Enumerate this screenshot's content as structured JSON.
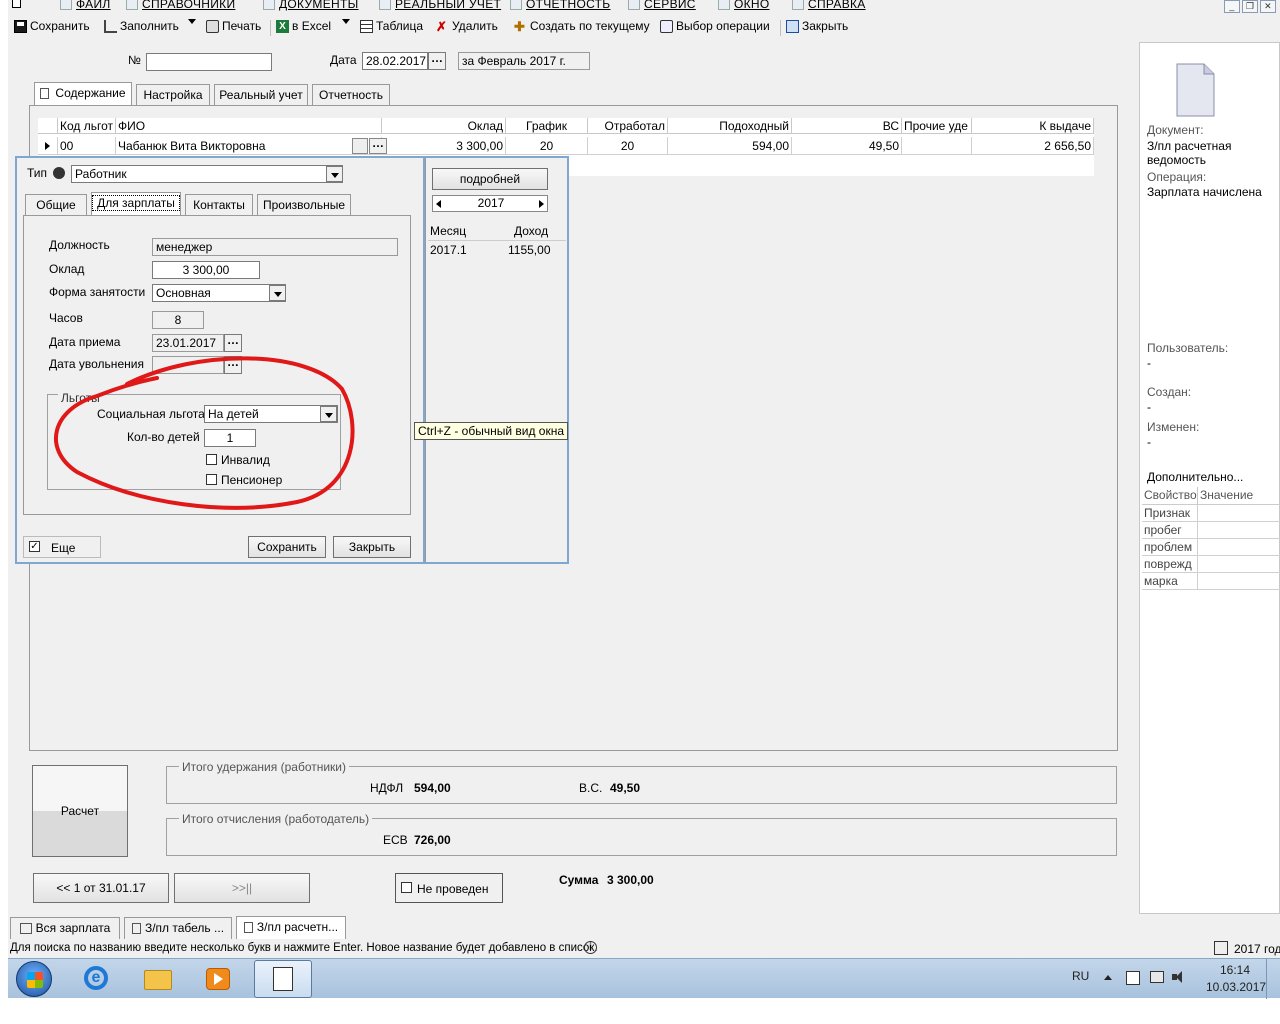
{
  "menu": [
    "ФАЙЛ",
    "СПРАВОЧНИКИ",
    "ДОКУМЕНТЫ",
    "РЕАЛЬНЫЙ УЧЕТ",
    "ОТЧЕТНОСТЬ",
    "СЕРВИС",
    "ОКНО",
    "СПРАВКА"
  ],
  "toolbar": {
    "save": "Сохранить",
    "fill": "Заполнить",
    "print": "Печать",
    "excel": "в Excel",
    "table": "Таблица",
    "delete": "Удалить",
    "create_from_current": "Создать по текущему",
    "choose_operation": "Выбор операции",
    "close": "Закрыть"
  },
  "header": {
    "number_label": "№",
    "number_value": "",
    "date_label": "Дата",
    "date_value": "28.02.2017",
    "period_value": "за Февраль 2017 г."
  },
  "tabs": [
    "Содержание",
    "Настройка",
    "Реальный учет",
    "Отчетность"
  ],
  "grid": {
    "columns": [
      "Код льгот",
      "ФИО",
      "Оклад",
      "График",
      "Отработал",
      "Подоходный",
      "ВС",
      "Прочие уде",
      "К выдаче"
    ],
    "rows": [
      {
        "code": "00",
        "fio": "Чабанюк Вита Викторовна",
        "oklad": "3 300,00",
        "grafik": "20",
        "otrabotal": "20",
        "podohodny": "594,00",
        "vs": "49,50",
        "prochie": "",
        "k_vydache": "2 656,50"
      }
    ]
  },
  "popup": {
    "type_label": "Тип",
    "type_value": "Работник",
    "tabs": [
      "Общие",
      "Для зарплаты",
      "Контакты",
      "Произвольные"
    ],
    "position_label": "Должность",
    "position_value": "менеджер",
    "salary_label": "Оклад",
    "salary_value": "3 300,00",
    "employment_label": "Форма занятости",
    "employment_value": "Основная",
    "hours_label": "Часов",
    "hours_value": "8",
    "hire_label": "Дата приема",
    "hire_value": "23.01.2017",
    "dismiss_label": "Дата увольнения",
    "dismiss_value": "",
    "benefits_title": "Льготы",
    "social_label": "Социальная льгота",
    "social_value": "На детей",
    "children_label": "Кол-во детей",
    "children_value": "1",
    "invalid_label": "Инвалид",
    "pensioner_label": "Пенсионер",
    "more_label": "Еще",
    "save_label": "Сохранить",
    "close_label": "Закрыть",
    "details_label": "подробней",
    "year_value": "2017",
    "month_col": "Месяц",
    "income_col": "Доход",
    "income_rows": [
      {
        "month": "2017.1",
        "income": "1155,00"
      }
    ]
  },
  "tooltip": "Ctrl+Z - обычный вид окна",
  "right_panel": {
    "doc_label": "Документ:",
    "doc_value": "З/пл расчетная ведомость",
    "op_label": "Операция:",
    "op_value": "Зарплата начислена",
    "user_label": "Пользователь:",
    "user_value": "-",
    "created_label": "Создан:",
    "created_value": "-",
    "changed_label": "Изменен:",
    "changed_value": "-",
    "extra_label": "Дополнительно...",
    "prop_col": "Свойство",
    "value_col": "Значение",
    "props": [
      "Признак",
      "пробег",
      "проблем",
      "поврежд",
      "марка"
    ]
  },
  "totals": {
    "calc_label": "Расчет",
    "deductions_title": "Итого удержания (работники)",
    "ndfl_label": "НДФЛ",
    "ndfl_value": "594,00",
    "vs_label": "В.С.",
    "vs_value": "49,50",
    "charges_title": "Итого отчисления (работодатель)",
    "esv_label": "ЕСВ",
    "esv_value": "726,00",
    "nav_prev": "<< 1 от 31.01.17",
    "nav_next": ">>||",
    "not_posted": "Не проведен",
    "sum_label": "Сумма",
    "sum_value": "3 300,00"
  },
  "window_tabs": [
    "Вся зарплата",
    "З/пл табель ...",
    "З/пл расчетн..."
  ],
  "statusbar": {
    "hint": "Для поиска по названию введите несколько букв и нажмите Enter. Новое название будет добавлено в список.",
    "year": "2017 год"
  },
  "taskbar": {
    "lang": "RU",
    "time": "16:14",
    "date": "10.03.2017"
  }
}
